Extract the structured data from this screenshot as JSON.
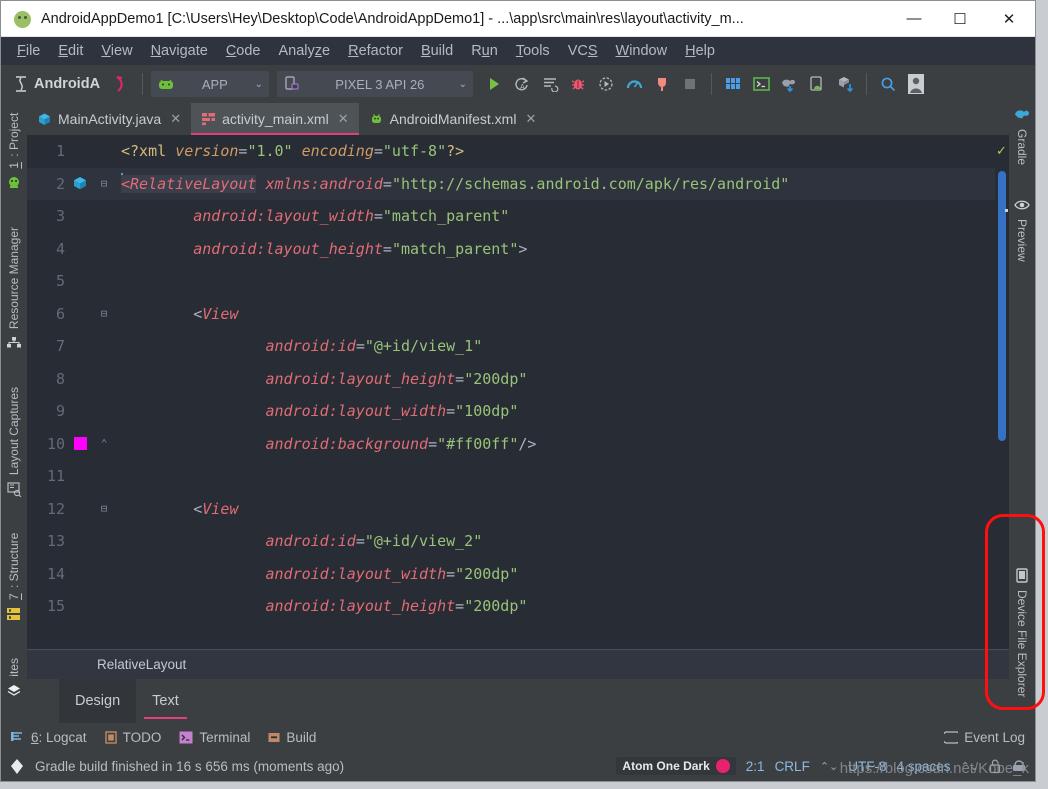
{
  "window": {
    "title": "AndroidAppDemo1 [C:\\Users\\Hey\\Desktop\\Code\\AndroidAppDemo1] - ...\\app\\src\\main\\res\\layout\\activity_m...",
    "app_icon": "android-head-icon",
    "minimize": "—",
    "maximize": "☐",
    "close": "✕"
  },
  "menubar": {
    "items": [
      {
        "pre": "",
        "mn": "F",
        "post": "ile"
      },
      {
        "pre": "",
        "mn": "E",
        "post": "dit"
      },
      {
        "pre": "",
        "mn": "V",
        "post": "iew"
      },
      {
        "pre": "",
        "mn": "N",
        "post": "avigate"
      },
      {
        "pre": "",
        "mn": "C",
        "post": "ode"
      },
      {
        "pre": "Analy",
        "mn": "z",
        "post": "e"
      },
      {
        "pre": "",
        "mn": "R",
        "post": "efactor"
      },
      {
        "pre": "",
        "mn": "B",
        "post": "uild"
      },
      {
        "pre": "R",
        "mn": "u",
        "post": "n"
      },
      {
        "pre": "",
        "mn": "T",
        "post": "ools"
      },
      {
        "pre": "VC",
        "mn": "S",
        "post": ""
      },
      {
        "pre": "",
        "mn": "W",
        "post": "indow"
      },
      {
        "pre": "",
        "mn": "H",
        "post": "elp"
      }
    ]
  },
  "toolbar": {
    "product_label": "AndroidA",
    "module_combo": {
      "label": "APP",
      "icon": "android-robot-icon",
      "chevron": "⌄"
    },
    "device_combo": {
      "label": "PIXEL 3 API 26",
      "icon": "device-phone-icon",
      "chevron": "⌄"
    },
    "actions": [
      {
        "name": "run-button",
        "glyph": "run"
      },
      {
        "name": "apply-changes-button",
        "glyph": "apply-changes"
      },
      {
        "name": "apply-code-changes-button",
        "glyph": "apply-code"
      },
      {
        "name": "debug-button",
        "glyph": "bug"
      },
      {
        "name": "run-with-coverage-button",
        "glyph": "coverage"
      },
      {
        "name": "profiler-button",
        "glyph": "profiler"
      },
      {
        "name": "attach-debugger-button",
        "glyph": "plug"
      },
      {
        "name": "stop-button",
        "glyph": "stop"
      }
    ],
    "right_actions": [
      {
        "name": "sdk-manager-button",
        "glyph": "grid"
      },
      {
        "name": "terminal-button",
        "glyph": "terminal"
      },
      {
        "name": "gradle-sync-button",
        "glyph": "elephant-sync"
      },
      {
        "name": "avd-manager-button",
        "glyph": "avd"
      },
      {
        "name": "sdk-download-button",
        "glyph": "cube-download"
      },
      {
        "name": "search-everywhere-button",
        "glyph": "search"
      },
      {
        "name": "user-account-button",
        "glyph": "avatar"
      }
    ]
  },
  "left_rail": [
    {
      "label_pre": "",
      "label_mn": "1",
      "label_post": ": Project",
      "icon": "project-icon"
    },
    {
      "label_pre": "Resource Manager",
      "label_mn": "",
      "label_post": "",
      "icon": "resource-manager-icon"
    },
    {
      "label_pre": "Layout Captures",
      "label_mn": "",
      "label_post": "",
      "icon": "layout-captures-icon"
    },
    {
      "label_pre": "",
      "label_mn": "7",
      "label_post": ": Structure",
      "icon": "structure-icon"
    },
    {
      "label_pre": "ites",
      "label_mn": "",
      "label_post": "",
      "icon": "favorites-icon"
    }
  ],
  "right_rail": [
    {
      "label": "Gradle",
      "icon": "gradle-elephant-icon"
    },
    {
      "label": "Preview",
      "icon": "eye-icon"
    },
    {
      "label": "Device File Explorer",
      "icon": "device-file-explorer-icon"
    }
  ],
  "editor_tabs": [
    {
      "label": "MainActivity.java",
      "icon": "java-class-icon",
      "active": false,
      "close": "✕"
    },
    {
      "label": "activity_main.xml",
      "icon": "layout-xml-icon",
      "active": true,
      "close": "✕"
    },
    {
      "label": "AndroidManifest.xml",
      "icon": "android-manifest-icon",
      "active": false,
      "close": "✕"
    }
  ],
  "editor": {
    "filename": "activity_main.xml",
    "lines": [
      {
        "num": "1",
        "indent": 0,
        "marker": "",
        "fold": "",
        "current": false,
        "tokens": [
          {
            "t": "pi",
            "v": "<?xml "
          },
          {
            "t": "kw",
            "v": "version"
          },
          {
            "t": "pl",
            "v": "="
          },
          {
            "t": "str",
            "v": "\"1.0\""
          },
          {
            "t": "pl",
            "v": " "
          },
          {
            "t": "kw",
            "v": "encoding"
          },
          {
            "t": "pl",
            "v": "="
          },
          {
            "t": "str",
            "v": "\"utf-8\""
          },
          {
            "t": "pi",
            "v": "?>"
          }
        ]
      },
      {
        "num": "2",
        "indent": 0,
        "marker": "layout-preview-icon",
        "fold": "⊟",
        "current": true,
        "tokens": [
          {
            "t": "caret",
            "v": ""
          },
          {
            "t": "tag-sel",
            "v": "<RelativeLayout"
          },
          {
            "t": "pl",
            "v": " "
          },
          {
            "t": "attr",
            "v": "xmlns:android"
          },
          {
            "t": "pl",
            "v": "="
          },
          {
            "t": "str",
            "v": "\"http://schemas.android.com/apk/res/android\""
          }
        ]
      },
      {
        "num": "3",
        "indent": 4,
        "marker": "",
        "fold": "",
        "current": false,
        "tokens": [
          {
            "t": "attr",
            "v": "android:layout_width"
          },
          {
            "t": "pl",
            "v": "="
          },
          {
            "t": "str",
            "v": "\"match_parent\""
          }
        ]
      },
      {
        "num": "4",
        "indent": 4,
        "marker": "",
        "fold": "",
        "current": false,
        "tokens": [
          {
            "t": "attr",
            "v": "android:layout_height"
          },
          {
            "t": "pl",
            "v": "="
          },
          {
            "t": "str",
            "v": "\"match_parent\""
          },
          {
            "t": "pl",
            "v": ">"
          }
        ]
      },
      {
        "num": "5",
        "indent": 0,
        "marker": "",
        "fold": "",
        "current": false,
        "tokens": []
      },
      {
        "num": "6",
        "indent": 4,
        "marker": "",
        "fold": "⊟",
        "current": false,
        "tokens": [
          {
            "t": "pl",
            "v": "<"
          },
          {
            "t": "tag",
            "v": "View"
          }
        ]
      },
      {
        "num": "7",
        "indent": 8,
        "marker": "",
        "fold": "",
        "current": false,
        "tokens": [
          {
            "t": "attr",
            "v": "android:id"
          },
          {
            "t": "pl",
            "v": "="
          },
          {
            "t": "str",
            "v": "\"@+id/view_1\""
          }
        ]
      },
      {
        "num": "8",
        "indent": 8,
        "marker": "",
        "fold": "",
        "current": false,
        "tokens": [
          {
            "t": "attr",
            "v": "android:layout_height"
          },
          {
            "t": "pl",
            "v": "="
          },
          {
            "t": "str",
            "v": "\"200dp\""
          }
        ]
      },
      {
        "num": "9",
        "indent": 8,
        "marker": "",
        "fold": "",
        "current": false,
        "tokens": [
          {
            "t": "attr",
            "v": "android:layout_width"
          },
          {
            "t": "pl",
            "v": "="
          },
          {
            "t": "str",
            "v": "\"100dp\""
          }
        ]
      },
      {
        "num": "10",
        "indent": 8,
        "marker": "color-swatch-magenta",
        "fold": "⌃",
        "current": false,
        "tokens": [
          {
            "t": "attr",
            "v": "android:background"
          },
          {
            "t": "pl",
            "v": "="
          },
          {
            "t": "str",
            "v": "\"#ff00ff\""
          },
          {
            "t": "pl",
            "v": "/>"
          }
        ]
      },
      {
        "num": "11",
        "indent": 0,
        "marker": "",
        "fold": "",
        "current": false,
        "tokens": []
      },
      {
        "num": "12",
        "indent": 4,
        "marker": "",
        "fold": "⊟",
        "current": false,
        "tokens": [
          {
            "t": "pl",
            "v": "<"
          },
          {
            "t": "tag",
            "v": "View"
          }
        ]
      },
      {
        "num": "13",
        "indent": 8,
        "marker": "",
        "fold": "",
        "current": false,
        "tokens": [
          {
            "t": "attr",
            "v": "android:id"
          },
          {
            "t": "pl",
            "v": "="
          },
          {
            "t": "str",
            "v": "\"@+id/view_2\""
          }
        ]
      },
      {
        "num": "14",
        "indent": 8,
        "marker": "",
        "fold": "",
        "current": false,
        "tokens": [
          {
            "t": "attr",
            "v": "android:layout_width"
          },
          {
            "t": "pl",
            "v": "="
          },
          {
            "t": "str",
            "v": "\"200dp\""
          }
        ]
      },
      {
        "num": "15",
        "indent": 8,
        "marker": "",
        "fold": "",
        "current": false,
        "tokens": [
          {
            "t": "attr",
            "v": "android:layout_height"
          },
          {
            "t": "pl",
            "v": "="
          },
          {
            "t": "str",
            "v": "\"200dp\""
          }
        ]
      }
    ],
    "inspection_status": "✓",
    "color_swatch": "#ff00ff"
  },
  "breadcrumb": {
    "text": "RelativeLayout"
  },
  "design_tabs": [
    {
      "label": "Design",
      "active": true,
      "selected": false
    },
    {
      "label": "Text",
      "active": false,
      "selected": true
    }
  ],
  "tool_windows": [
    {
      "pre": "",
      "mn": "6",
      "post": ": Logcat",
      "icon": "logcat-icon"
    },
    {
      "pre": "TODO",
      "mn": "",
      "post": "",
      "icon": "todo-icon"
    },
    {
      "pre": "Terminal",
      "mn": "",
      "post": "",
      "icon": "terminal-icon"
    },
    {
      "pre": "Build",
      "mn": "",
      "post": "",
      "icon": "build-icon"
    }
  ],
  "event_log": {
    "label": "Event Log",
    "icon": "event-log-icon"
  },
  "statusbar": {
    "build_message": "Gradle build finished in 16 s 656 ms (moments ago)",
    "build_icon": "gradle-status-icon",
    "theme_name": "Atom One Dark",
    "theme_dot_color": "#e8226f",
    "caret_position": "2:1",
    "line_separator": "CRLF",
    "line_separator_arrows": "⌃⌄",
    "encoding": "UTF-8",
    "indent": "4 spaces",
    "lock_icon": "unlock-icon",
    "inspector_icon": "inspector-icon"
  },
  "watermark": {
    "text": "https://blog.csdn.net/Kobe_k"
  },
  "annotations": [
    {
      "name": "device-file-explorer-highlight",
      "color": "#ff1010"
    }
  ]
}
